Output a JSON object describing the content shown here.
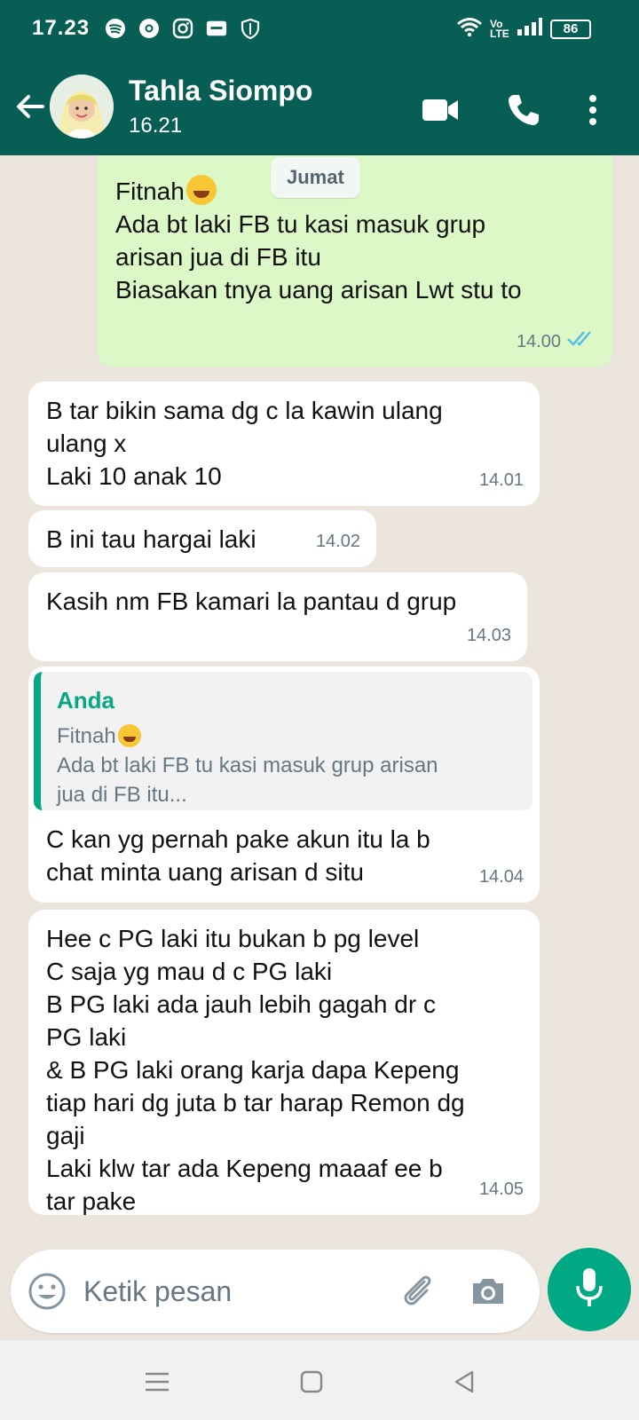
{
  "status_bar": {
    "time": "17.23",
    "battery": "86",
    "network": "Vo LTE",
    "left_icons": [
      "spotify-icon",
      "chrome-icon",
      "instagram-icon",
      "app-icon",
      "shield-icon"
    ]
  },
  "header": {
    "contact_name": "Tahla Siompo",
    "contact_status": "16.21",
    "colors": {
      "header_bg": "#075e54",
      "accent": "#00a884"
    }
  },
  "date_chip": "Jumat",
  "messages": [
    {
      "direction": "out",
      "text_line1": "Fitnah",
      "text_rest": "Ada bt laki FB tu kasi masuk grup\narisan jua di FB itu\nBiasakan tnya uang arisan Lwt stu to",
      "time": "14.00",
      "ticks": "read"
    },
    {
      "direction": "in",
      "text": "B tar bikin sama dg c la kawin ulang\nulang x\nLaki 10 anak 10",
      "time": "14.01"
    },
    {
      "direction": "in",
      "text": "B ini tau hargai laki",
      "time": "14.02"
    },
    {
      "direction": "in",
      "text": "Kasih nm FB kamari la pantau d grup",
      "time": "14.03"
    },
    {
      "direction": "in",
      "quote": {
        "author": "Anda",
        "text_line1": "Fitnah",
        "text_rest": "Ada bt laki FB tu kasi masuk grup arisan\njua di FB itu..."
      },
      "text": "C kan yg pernah pake akun itu la b\nchat minta uang arisan d situ",
      "time": "14.04"
    },
    {
      "direction": "in",
      "text": "Hee c PG laki itu bukan b pg level\nC saja yg mau d c PG laki\nB PG laki ada jauh lebih gagah dr c\nPG laki\n& B PG laki orang karja dapa Kepeng\ntiap hari dg juta b tar harap Remon dg\ngaji\nLaki klw tar ada Kepeng maaaf ee b\ntar pake",
      "time": "14.05"
    }
  ],
  "composer": {
    "placeholder": "Ketik pesan"
  }
}
